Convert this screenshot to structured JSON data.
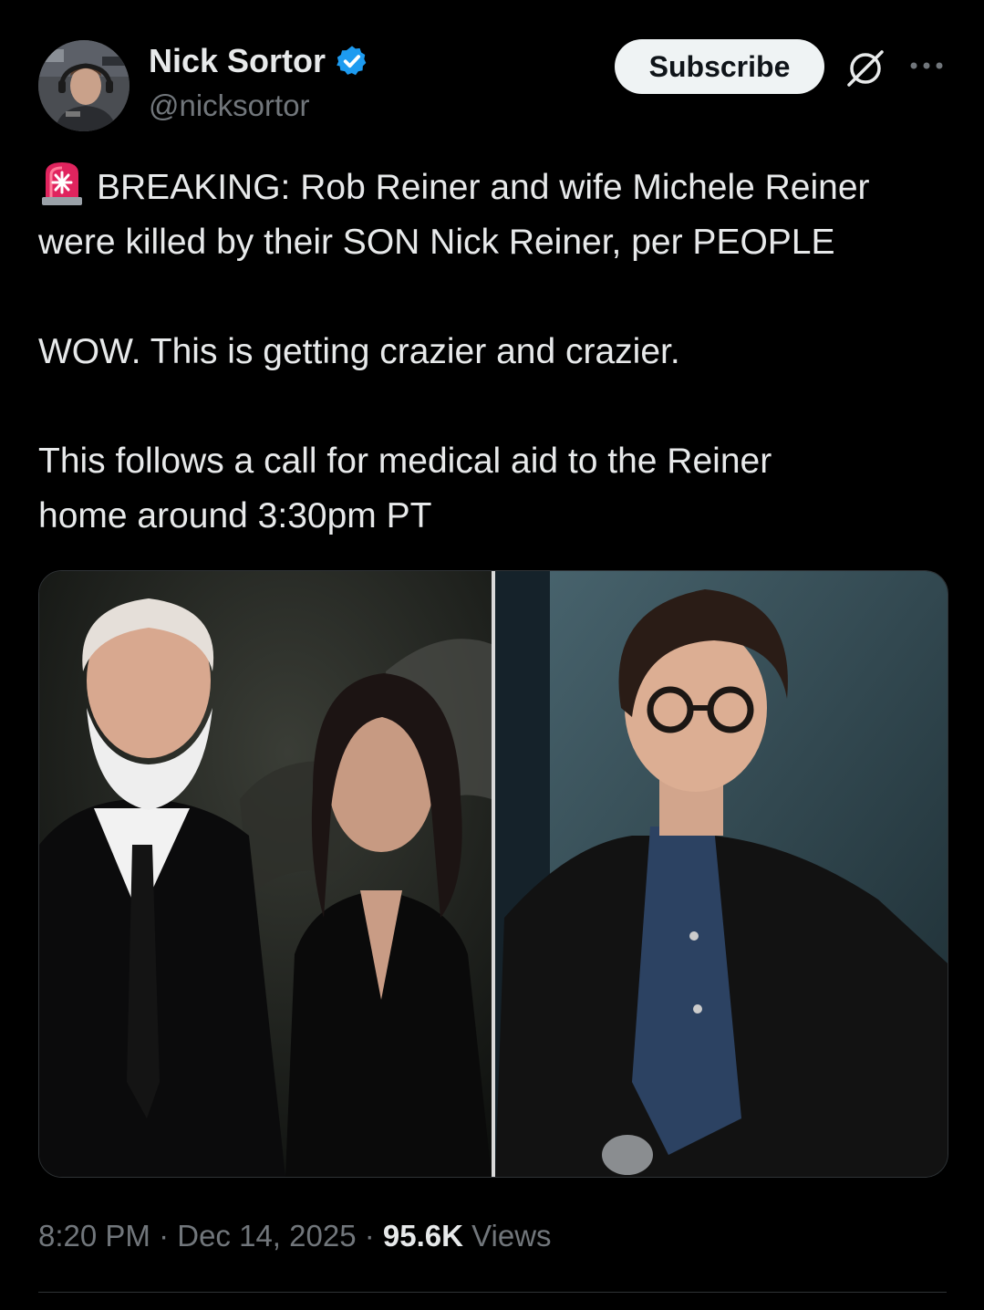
{
  "author": {
    "display_name": "Nick Sortor",
    "handle": "@nicksortor",
    "verified": true,
    "avatar_icon": "user-avatar"
  },
  "actions": {
    "subscribe_label": "Subscribe",
    "grok_icon": "grok-icon",
    "more_icon": "more-options-icon"
  },
  "tweet": {
    "emoji": "siren-icon",
    "line1": "BREAKING: Rob Reiner and wife Michele Reiner",
    "line2": "were killed by their SON Nick Reiner, per PEOPLE",
    "line3": "WOW. This is getting crazier and crazier.",
    "line4": "This follows a call for medical aid to the Reiner",
    "line5": "home around 3:30pm PT"
  },
  "media": {
    "images": [
      "photo-couple",
      "photo-son"
    ]
  },
  "meta": {
    "time": "8:20 PM",
    "sep1": " · ",
    "date": "Dec 14, 2025",
    "sep2": " · ",
    "views_count": "95.6K",
    "views_label": " Views"
  },
  "colors": {
    "background": "#000000",
    "text_primary": "#e7e9ea",
    "text_secondary": "#71767b",
    "verified_blue": "#1d9bf0",
    "siren_red": "#e0245e",
    "button_bg": "#eff3f4"
  }
}
